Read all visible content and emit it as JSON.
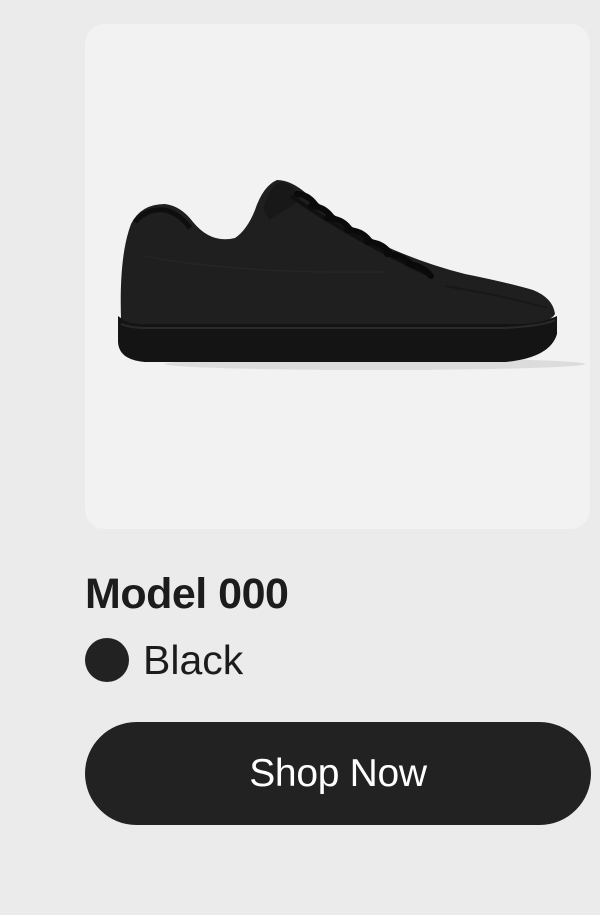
{
  "product": {
    "name": "Model 000",
    "image_alt": "black-sneaker-image",
    "color": {
      "label": "Black",
      "swatch_hex": "#222222"
    }
  },
  "actions": {
    "shop_label": "Shop Now"
  },
  "colors": {
    "page_background": "#ebebeb",
    "image_background": "#f2f2f2",
    "button_background": "#222222",
    "button_text": "#ffffff"
  }
}
